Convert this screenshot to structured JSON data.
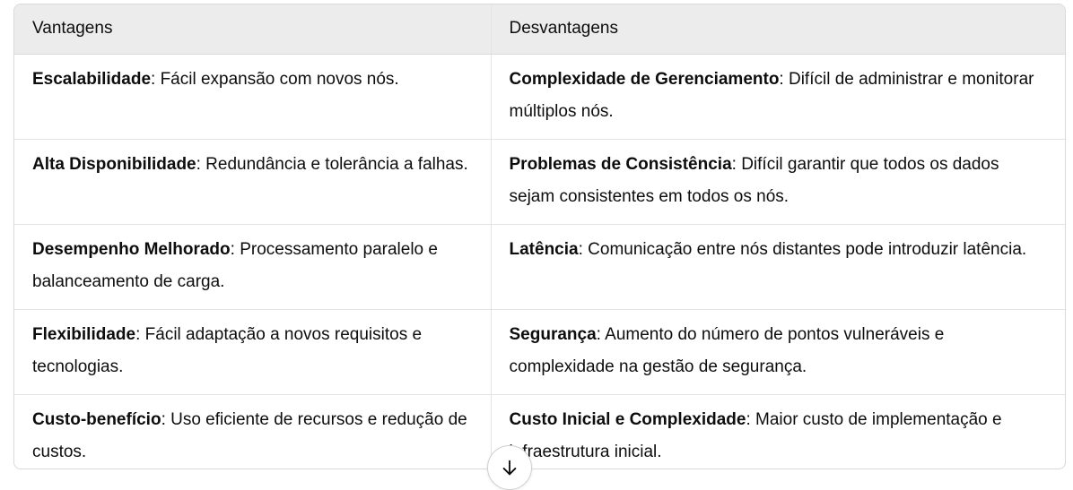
{
  "table": {
    "headers": [
      "Vantagens",
      "Desvantagens"
    ],
    "rows": [
      {
        "adv_term": "Escalabilidade",
        "adv_desc": ": Fácil expansão com novos nós.",
        "dis_term": "Complexidade de Gerenciamento",
        "dis_desc": ": Difícil de administrar e monitorar múltiplos nós."
      },
      {
        "adv_term": "Alta Disponibilidade",
        "adv_desc": ": Redundância e tolerância a falhas.",
        "dis_term": "Problemas de Consistência",
        "dis_desc": ": Difícil garantir que todos os dados sejam consistentes em todos os nós."
      },
      {
        "adv_term": "Desempenho Melhorado",
        "adv_desc": ": Processamento paralelo e balanceamento de carga.",
        "dis_term": "Latência",
        "dis_desc": ": Comunicação entre nós distantes pode introduzir latência."
      },
      {
        "adv_term": "Flexibilidade",
        "adv_desc": ": Fácil adaptação a novos requisitos e tecnologias.",
        "dis_term": "Segurança",
        "dis_desc": ": Aumento do número de pontos vulneráveis e complexidade na gestão de segurança."
      },
      {
        "adv_term": "Custo-benefício",
        "adv_desc": ": Uso eficiente de recursos e redução de custos.",
        "dis_term": "Custo Inicial e Complexidade",
        "dis_desc": ": Maior custo de implementação e infraestrutura inicial."
      }
    ]
  },
  "scroll_button": {
    "icon": "arrow-down-icon"
  }
}
